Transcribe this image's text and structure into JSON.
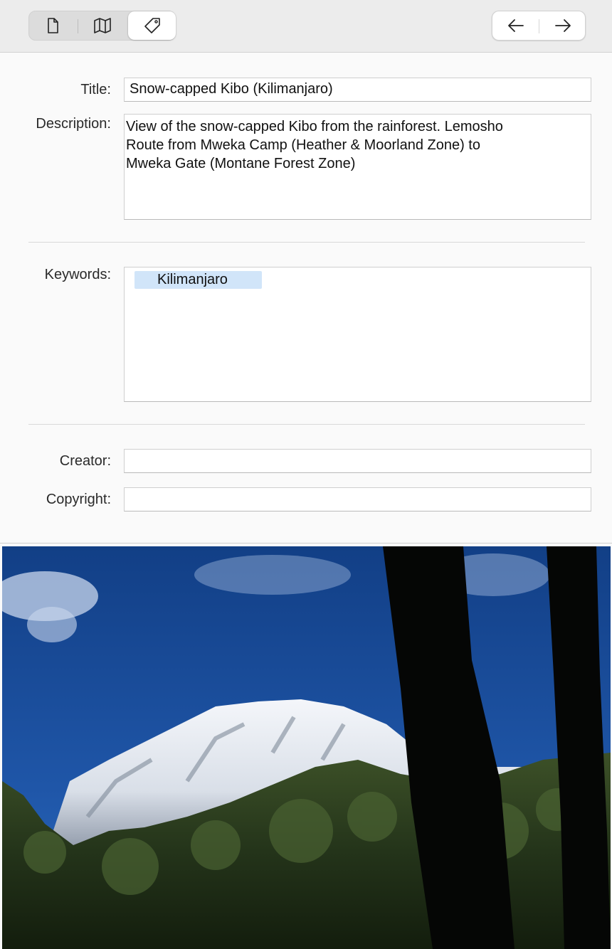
{
  "toolbar": {
    "segments": [
      {
        "name": "document-icon",
        "selected": false
      },
      {
        "name": "map-icon",
        "selected": false
      },
      {
        "name": "tag-icon",
        "selected": true
      }
    ],
    "nav": [
      {
        "name": "arrow-left-icon"
      },
      {
        "name": "arrow-right-icon"
      }
    ]
  },
  "form": {
    "title_label": "Title:",
    "title_value": "Snow-capped Kibo (Kilimanjaro)",
    "description_label": "Description:",
    "description_line1": "View of the snow-capped Kibo from the rainforest. Lemosho",
    "description_line2": "Route from Mweka Camp (Heather & Moorland Zone) to",
    "description_line3": "Mweka Gate (Montane Forest Zone)",
    "keywords_label": "Keywords:",
    "keywords": [
      "Kilimanjaro"
    ],
    "creator_label": "Creator:",
    "creator_value": "",
    "copyright_label": "Copyright:",
    "copyright_value": ""
  },
  "colors": {
    "toolbar_bg": "#ececec",
    "keyword_token": "#d1e5f9",
    "sky": "#1f4f9a"
  }
}
